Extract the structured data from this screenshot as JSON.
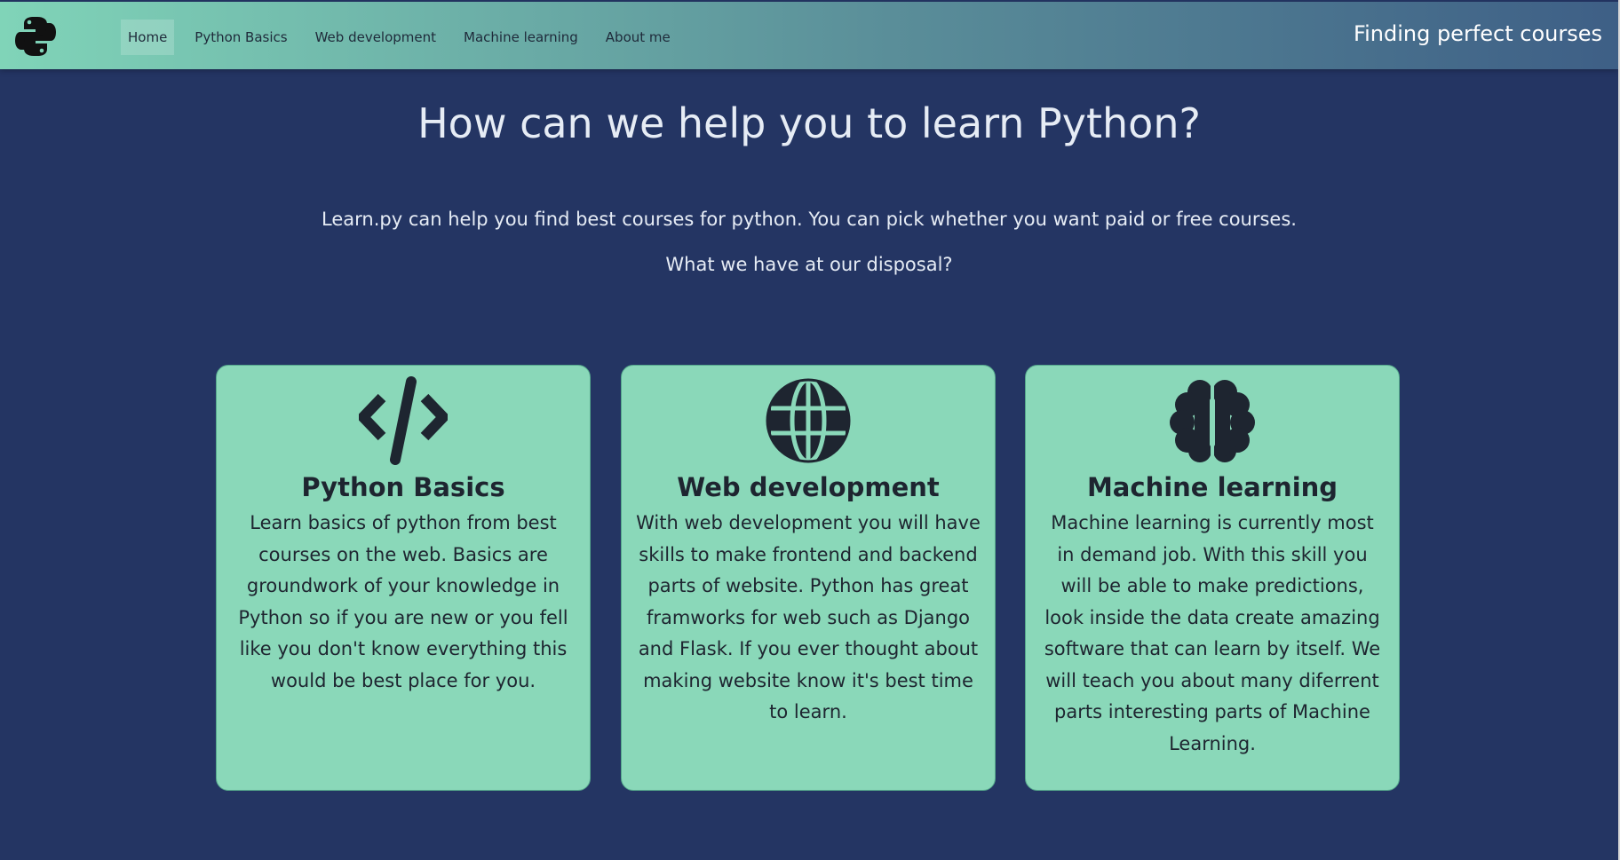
{
  "nav": {
    "items": [
      {
        "label": "Home",
        "active": true
      },
      {
        "label": "Python Basics",
        "active": false
      },
      {
        "label": "Web development",
        "active": false
      },
      {
        "label": "Machine learning",
        "active": false
      },
      {
        "label": "About me",
        "active": false
      }
    ],
    "tagline": "Finding perfect courses"
  },
  "hero": {
    "title": "How can we help you to learn Python?",
    "intro": "Learn.py can help you find best courses for python. You can pick whether you want paid or free courses.",
    "question": "What we have at our disposal?"
  },
  "cards": [
    {
      "icon": "code-icon",
      "title": "Python Basics",
      "text": "Learn basics of python from best courses on the web. Basics are groundwork of your knowledge in Python so if you are new or you fell like you don't know everything this would be best place for you."
    },
    {
      "icon": "globe-icon",
      "title": "Web development",
      "text": "With web development you will have skills to make frontend and backend parts of website. Python has great framworks for web such as Django and Flask. If you ever thought about making website know it's best time to learn."
    },
    {
      "icon": "brain-icon",
      "title": "Machine learning",
      "text": "Machine learning is currently most in demand job. With this skill you will be able to make predictions, look inside the data create amazing software that can learn by itself. We will teach you about many diferrent parts interesting parts of Machine Learning."
    }
  ],
  "colors": {
    "background": "#243563",
    "card": "#8ad8b9",
    "header_start": "#80d4b8",
    "header_end": "#3e5f86"
  }
}
